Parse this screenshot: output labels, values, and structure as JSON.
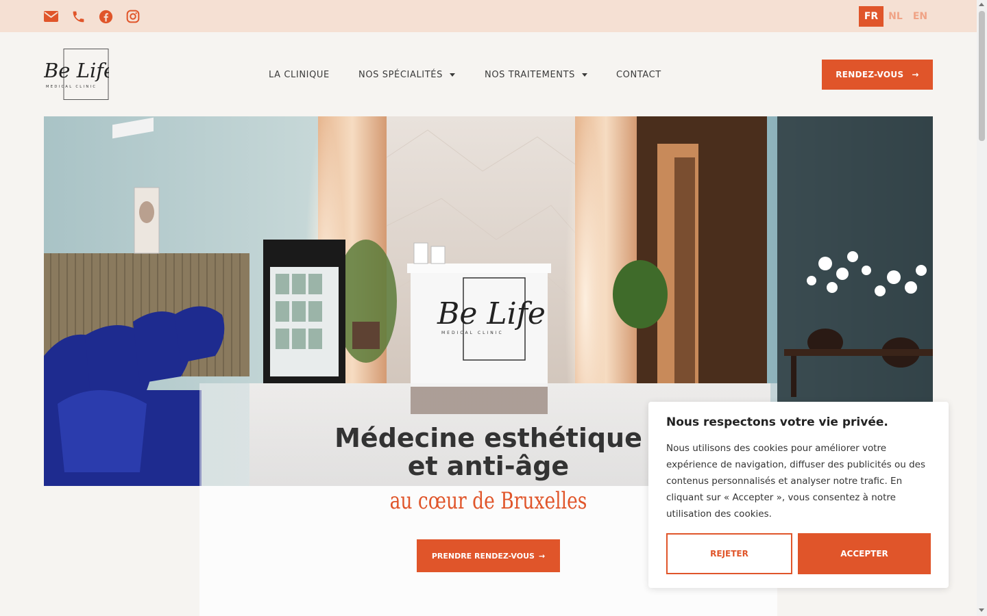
{
  "colors": {
    "accent": "#e0552a",
    "topbar": "#f5e0d3",
    "background": "#f6f4f1"
  },
  "topbar": {
    "icons": [
      "envelope-icon",
      "phone-icon",
      "facebook-icon",
      "instagram-icon"
    ],
    "languages": [
      {
        "label": "FR",
        "active": true
      },
      {
        "label": "NL",
        "active": false
      },
      {
        "label": "EN",
        "active": false
      }
    ]
  },
  "header": {
    "logo": {
      "line1": "Be Life",
      "line2": "MEDICAL CLINIC"
    },
    "nav": [
      {
        "label": "LA CLINIQUE"
      },
      {
        "label": "NOS SPÉCIALITÉS"
      },
      {
        "label": "NOS TRAITEMENTS"
      },
      {
        "label": "CONTACT"
      }
    ],
    "cta_label": "RENDEZ-VOUS",
    "cta_arrow": "→"
  },
  "hero": {
    "desk_logo": {
      "line1": "Be Life",
      "line2": "MEDICAL CLINIC"
    },
    "title_line1": "Médecine esthétique",
    "title_line2": "et anti-âge",
    "subtitle": "au cœur de Bruxelles",
    "cta_label": "PRENDRE RENDEZ-VOUS",
    "cta_arrow": "→"
  },
  "cookie": {
    "title": "Nous respectons votre vie privée.",
    "body": "Nous utilisons des cookies pour améliorer votre expérience de navigation, diffuser des publicités ou des contenus personnalisés et analyser notre trafic. En cliquant sur « Accepter », vous consentez à notre utilisation des cookies.",
    "reject_label": "REJETER",
    "accept_label": "ACCEPTER"
  }
}
